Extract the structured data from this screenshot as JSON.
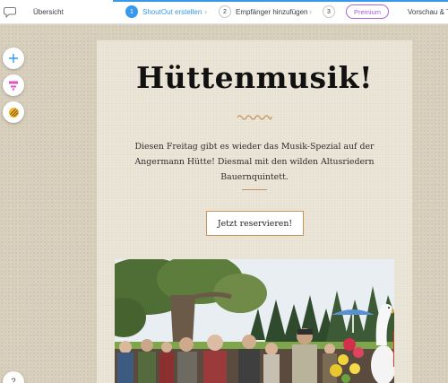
{
  "topbar": {
    "overview_label": "Übersicht",
    "steps": [
      {
        "number": "1",
        "label": "ShoutOut erstellen"
      },
      {
        "number": "2",
        "label": "Empfänger hinzufügen"
      },
      {
        "number": "3",
        "label": ""
      }
    ],
    "premium_label": "Premium",
    "preview_label": "Vorschau & Te",
    "accent_color": "#3899ec",
    "premium_color": "#a660e0"
  },
  "tools": {
    "add_icon": "plus-icon",
    "section_icon": "layout-section-icon",
    "background_icon": "background-pattern-icon"
  },
  "help": {
    "label": "?"
  },
  "card": {
    "title": "Hüttenmusik!",
    "description": "Diesen Freitag gibt es wieder das Musik-Spezial auf der Angermann Hütte! Diesmal mit den wilden Altusriedern Bauernquintett.",
    "button_label": "Jetzt reservieren!",
    "accent_color": "#c8935a",
    "photo_icon": "outdoor-gathering-photo"
  }
}
